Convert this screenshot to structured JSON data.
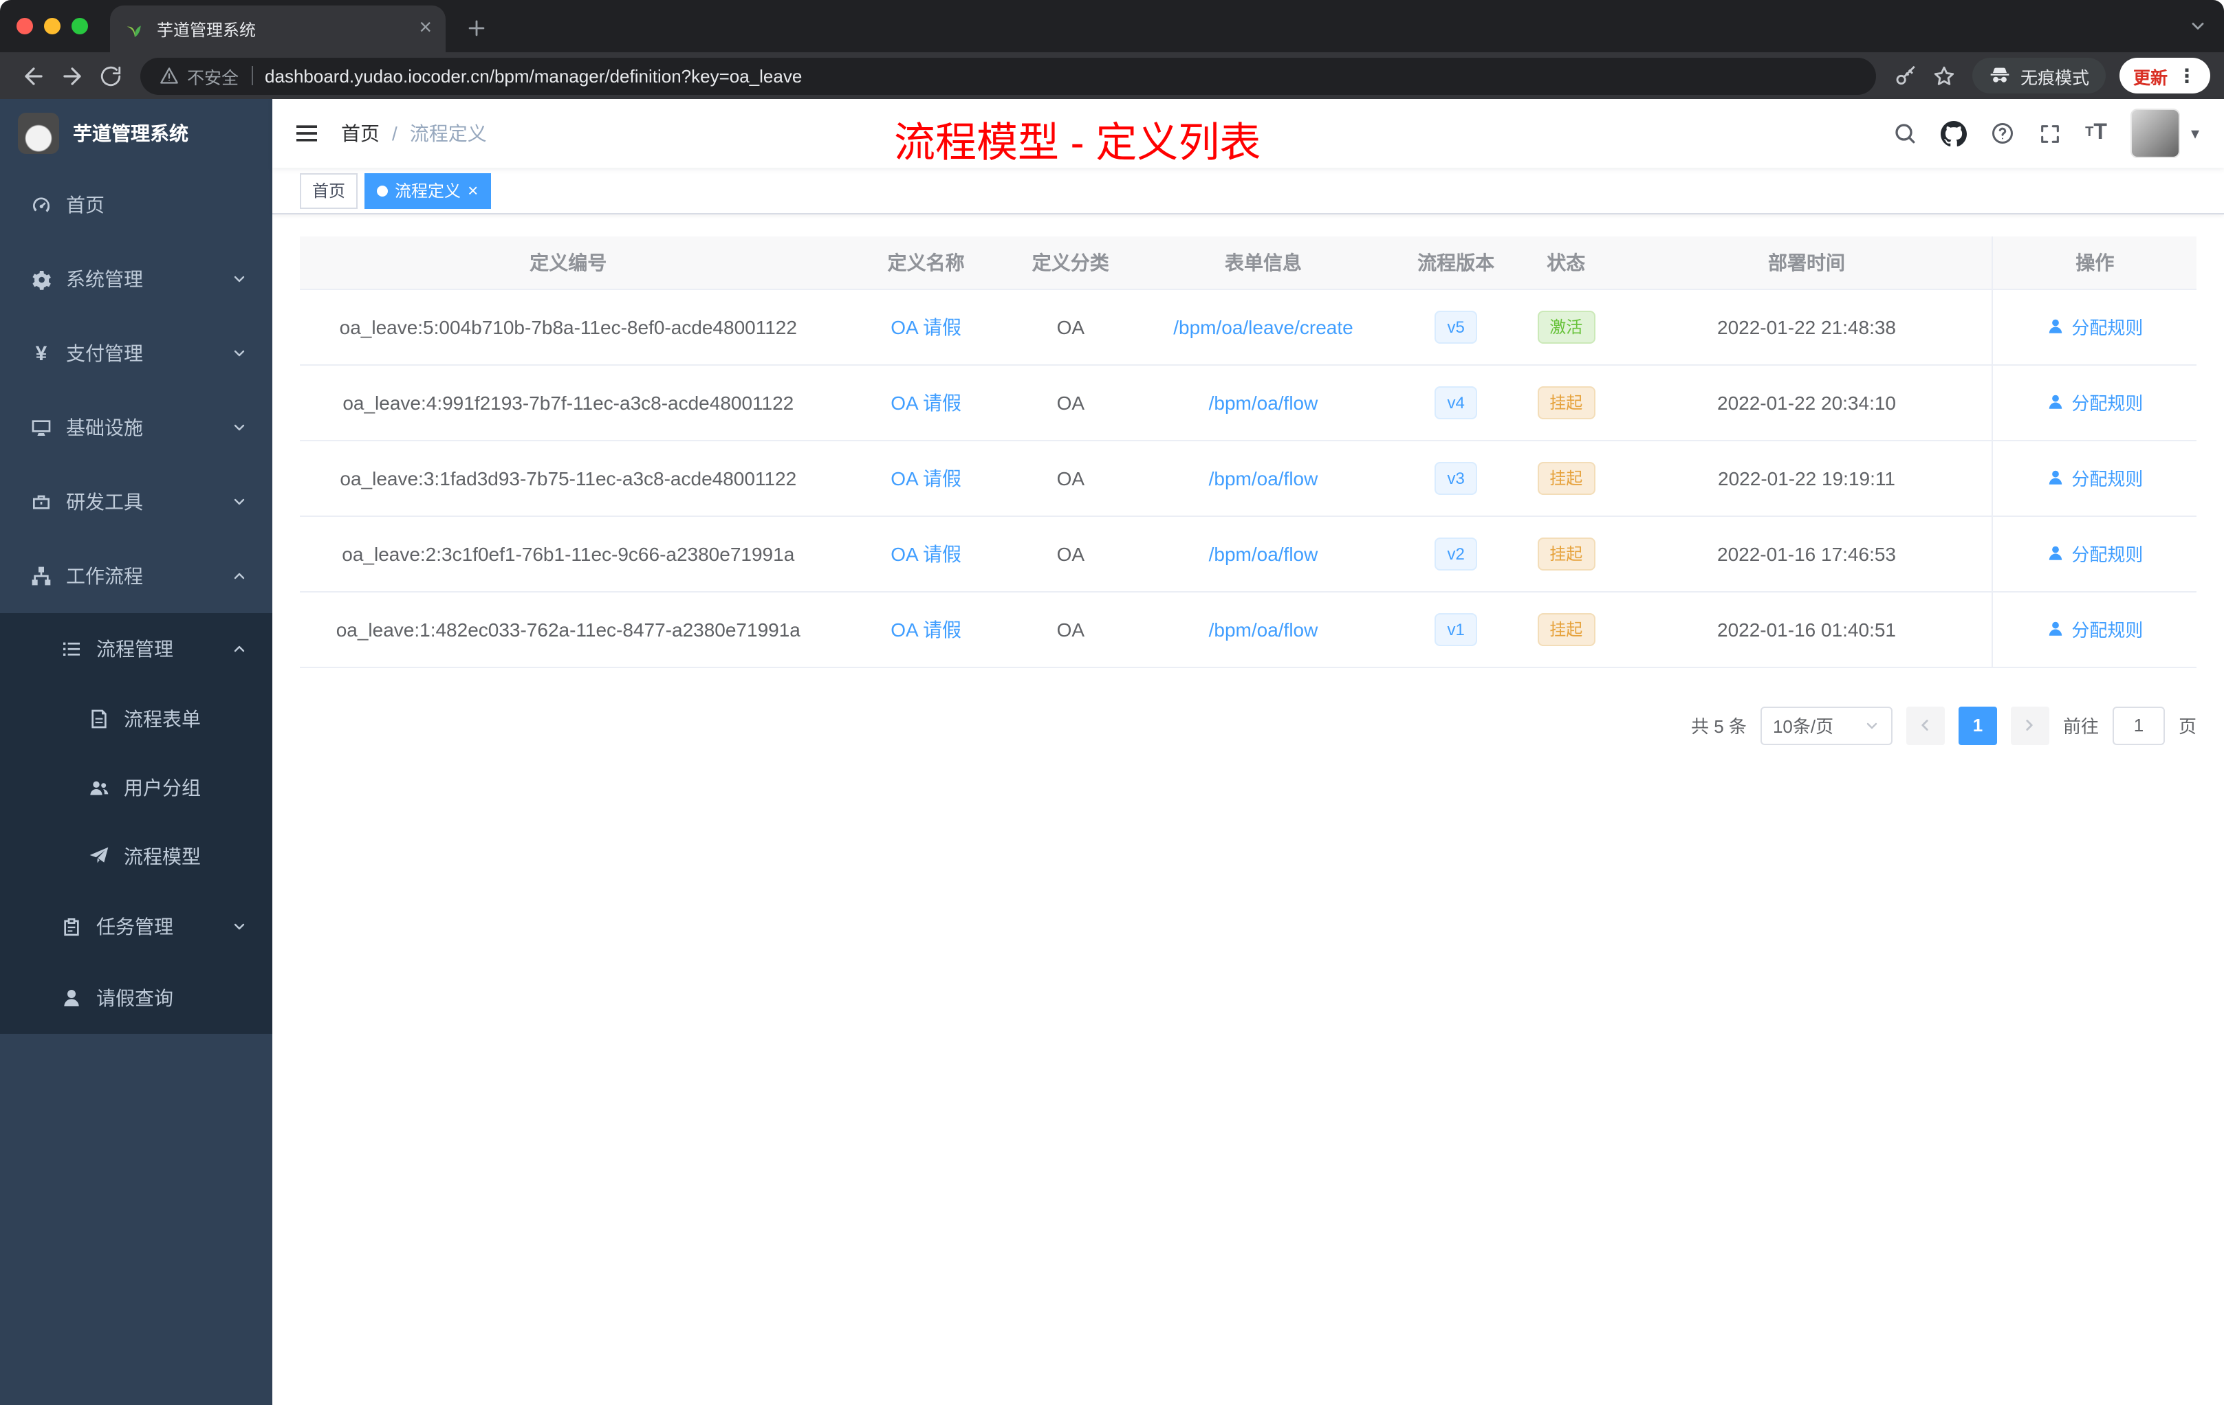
{
  "chrome": {
    "tab_title": "芋道管理系统",
    "security_label": "不安全",
    "url": "dashboard.yudao.iocoder.cn/bpm/manager/definition?key=oa_leave",
    "incognito_label": "无痕模式",
    "update_label": "更新"
  },
  "icons": {
    "yen": "¥",
    "kebab": "⋮",
    "caret_down": "▾",
    "close": "×",
    "font_size_small": "T",
    "font_size_large": "T"
  },
  "sidebar": {
    "logo_title": "芋道管理系统",
    "menu": [
      {
        "label": "首页"
      },
      {
        "label": "系统管理"
      },
      {
        "label": "支付管理"
      },
      {
        "label": "基础设施"
      },
      {
        "label": "研发工具"
      },
      {
        "label": "工作流程"
      },
      {
        "label": "流程管理"
      },
      {
        "label": "流程表单"
      },
      {
        "label": "用户分组"
      },
      {
        "label": "流程模型"
      },
      {
        "label": "任务管理"
      },
      {
        "label": "请假查询"
      }
    ]
  },
  "navbar": {
    "breadcrumb_home": "首页",
    "breadcrumb_separator": "/",
    "breadcrumb_current": "流程定义",
    "annotation": "流程模型 - 定义列表"
  },
  "tags": {
    "home": "首页",
    "current": "流程定义"
  },
  "table": {
    "columns": {
      "id": "定义编号",
      "name": "定义名称",
      "category": "定义分类",
      "form": "表单信息",
      "version": "流程版本",
      "status": "状态",
      "deploy_time": "部署时间",
      "actions": "操作"
    },
    "action_label": "分配规则",
    "rows": [
      {
        "id": "oa_leave:5:004b710b-7b8a-11ec-8ef0-acde48001122",
        "name": "OA 请假",
        "category": "OA",
        "form": "/bpm/oa/leave/create",
        "version": "v5",
        "status": "激活",
        "time": "2022-01-22 21:48:38"
      },
      {
        "id": "oa_leave:4:991f2193-7b7f-11ec-a3c8-acde48001122",
        "name": "OA 请假",
        "category": "OA",
        "form": "/bpm/oa/flow",
        "version": "v4",
        "status": "挂起",
        "time": "2022-01-22 20:34:10"
      },
      {
        "id": "oa_leave:3:1fad3d93-7b75-11ec-a3c8-acde48001122",
        "name": "OA 请假",
        "category": "OA",
        "form": "/bpm/oa/flow",
        "version": "v3",
        "status": "挂起",
        "time": "2022-01-22 19:19:11"
      },
      {
        "id": "oa_leave:2:3c1f0ef1-76b1-11ec-9c66-a2380e71991a",
        "name": "OA 请假",
        "category": "OA",
        "form": "/bpm/oa/flow",
        "version": "v2",
        "status": "挂起",
        "time": "2022-01-16 17:46:53"
      },
      {
        "id": "oa_leave:1:482ec033-762a-11ec-8477-a2380e71991a",
        "name": "OA 请假",
        "category": "OA",
        "form": "/bpm/oa/flow",
        "version": "v1",
        "status": "挂起",
        "time": "2022-01-16 01:40:51"
      }
    ]
  },
  "pagination": {
    "total": "共 5 条",
    "page_size": "10条/页",
    "current_page": "1",
    "goto_label": "前往",
    "goto_value": "1",
    "page_unit": "页"
  },
  "colors": {
    "accent": "#409EFF",
    "success_text": "#67C23A",
    "warning_text": "#E6A23C",
    "annotation_red": "#FF0000",
    "sidebar_bg": "#304156",
    "submenu_bg": "#1F2D3D"
  }
}
